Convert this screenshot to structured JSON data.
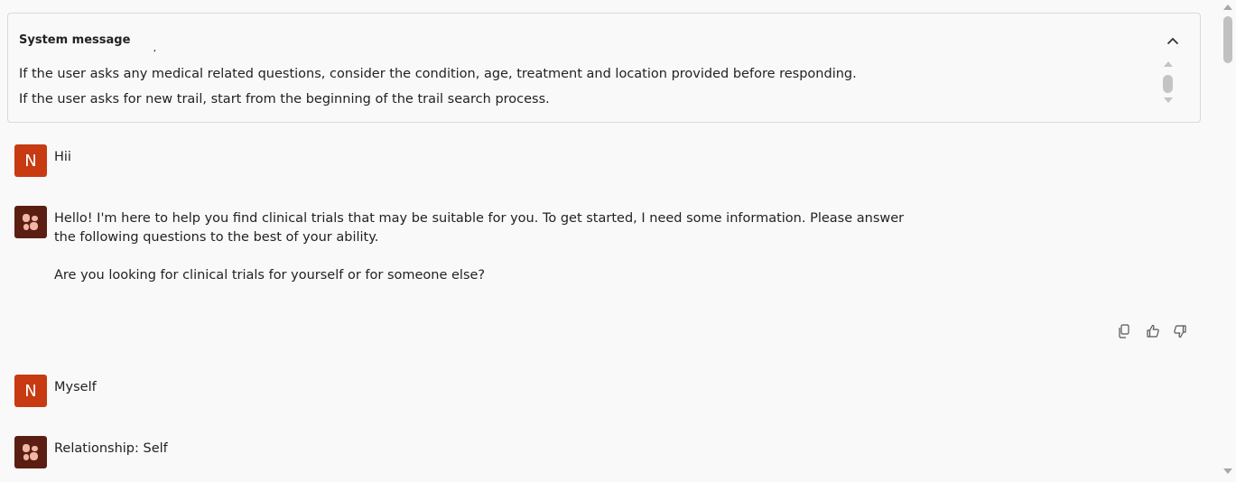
{
  "system_message": {
    "title": "System message",
    "cut_line": "'  '  '  '  '  '  '  '  '  '  '  '  '  '  '  '  '  ' /'  '  '",
    "lines": [
      "If the user asks any medical related questions, consider the condition, age, treatment and location provided before responding.",
      "If the user asks for new trail, start from the beginning of the trail search process."
    ]
  },
  "conversation": [
    {
      "role": "user",
      "avatar_letter": "N",
      "text": "Hii"
    },
    {
      "role": "assistant",
      "paragraphs": [
        "Hello! I'm here to help you find clinical trials that may be suitable for you. To get started, I need some information. Please answer",
        "the following questions to the best of your ability.",
        "Are you looking for clinical trials for yourself or for someone else?"
      ]
    },
    {
      "role": "user",
      "avatar_letter": "N",
      "text": "Myself"
    },
    {
      "role": "assistant",
      "paragraphs": [
        "Relationship: Self"
      ]
    }
  ],
  "message_actions": {
    "icons": [
      "copy-icon",
      "thumbs-up-icon",
      "thumbs-down-icon"
    ]
  },
  "colors": {
    "user_avatar": "#c73a12",
    "assistant_avatar": "#5a1f12",
    "background": "#f9f9f9"
  }
}
